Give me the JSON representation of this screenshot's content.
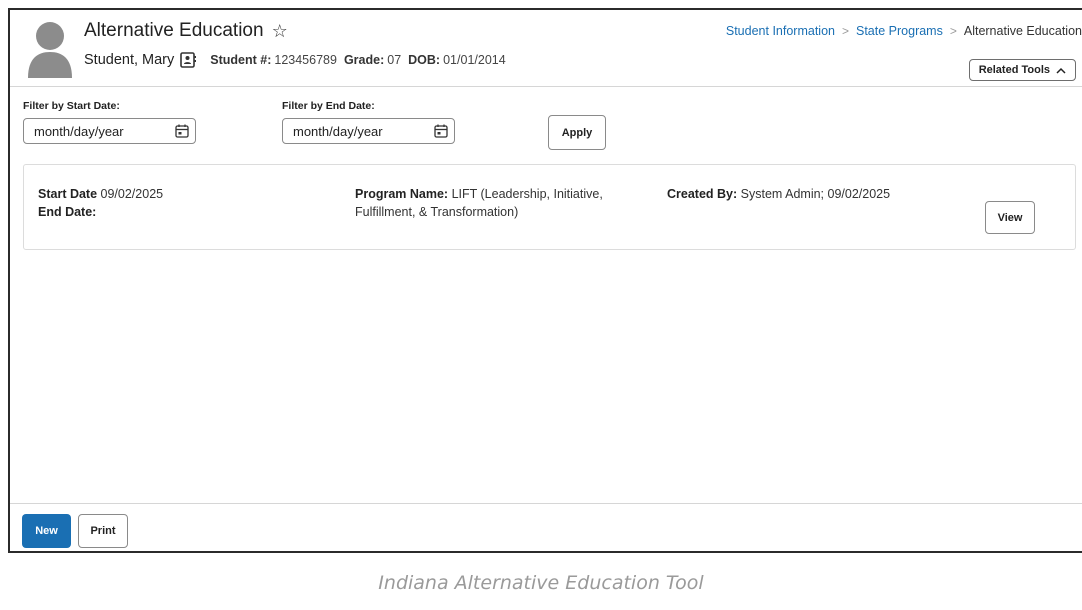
{
  "header": {
    "title": "Alternative Education",
    "student_name": "Student, Mary",
    "student_num_label": "Student #:",
    "student_num": "123456789",
    "grade_label": "Grade:",
    "grade": "07",
    "dob_label": "DOB:",
    "dob": "01/01/2014"
  },
  "breadcrumb": {
    "items": [
      "Student Information",
      "State Programs"
    ],
    "current": "Alternative Education",
    "separator": ">"
  },
  "related_tools": {
    "label": "Related Tools",
    "icon": "chevron-up-icon"
  },
  "filters": {
    "start": {
      "label": "Filter by Start Date:",
      "value": "month/day/year",
      "icon": "calendar-icon"
    },
    "end": {
      "label": "Filter by End Date:",
      "value": "month/day/year",
      "icon": "calendar-icon"
    },
    "apply_label": "Apply"
  },
  "record": {
    "start_date_label": "Start Date",
    "start_date": "09/02/2025",
    "end_date_label": "End Date:",
    "end_date": "",
    "program_label": "Program Name:",
    "program_line1": "LIFT (Leadership, Initiative,",
    "program_line2": "Fulfillment, & Transformation)",
    "created_by_label": "Created By:",
    "created_by": "System Admin; 09/02/2025",
    "view_label": "View"
  },
  "footer": {
    "new_label": "New",
    "print_label": "Print"
  },
  "caption": "Indiana Alternative Education Tool",
  "colors": {
    "accent": "#1a6fb3",
    "border": "#2b2b2b",
    "caption": "#9a9a9a"
  }
}
